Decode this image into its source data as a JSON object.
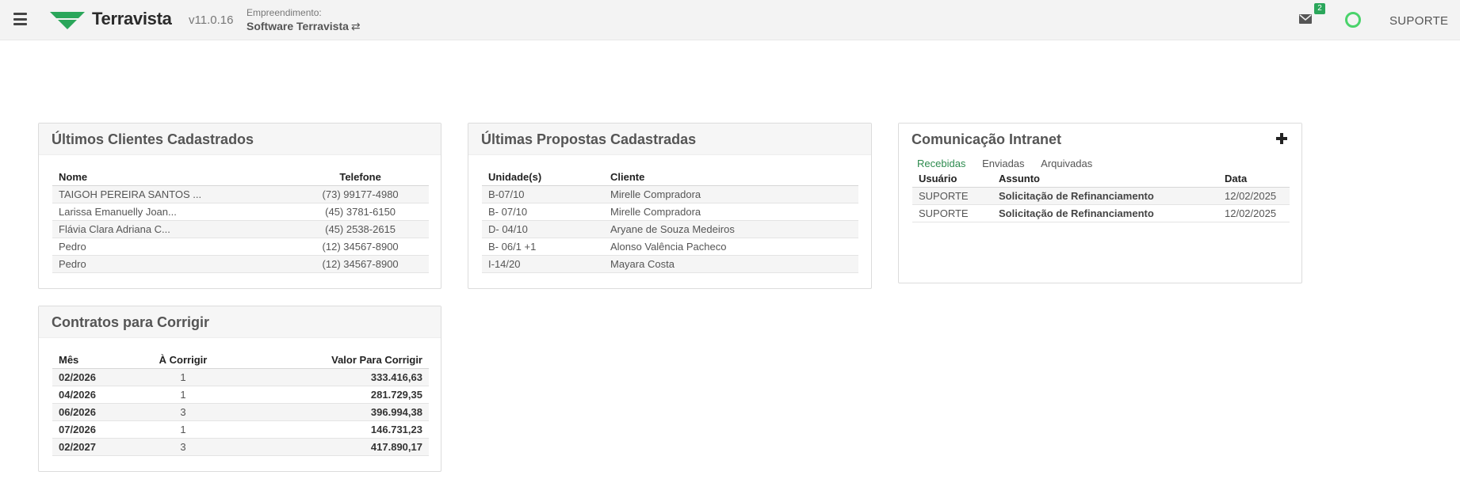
{
  "header": {
    "app_name": "Terravista",
    "version": "v11.0.16",
    "empreendimento_label": "Empreendimento:",
    "empreendimento_value": "Software Terravista",
    "swap_glyph": "⇄",
    "mail_badge": "2",
    "user_name": "SUPORTE",
    "brand_color": "#2aa65a",
    "status_color": "#4ad36b"
  },
  "clientes": {
    "title": "Últimos Clientes Cadastrados",
    "columns": [
      "Nome",
      "Telefone"
    ],
    "rows": [
      {
        "nome": "TAIGOH PEREIRA SANTOS ...",
        "telefone": "(73) 99177-4980"
      },
      {
        "nome": "Larissa Emanuelly Joan...",
        "telefone": "(45) 3781-6150"
      },
      {
        "nome": "Flávia Clara Adriana C...",
        "telefone": "(45) 2538-2615"
      },
      {
        "nome": "Pedro",
        "telefone": "(12) 34567-8900"
      },
      {
        "nome": "Pedro",
        "telefone": "(12) 34567-8900"
      }
    ]
  },
  "propostas": {
    "title": "Últimas Propostas Cadastradas",
    "columns": [
      "Unidade(s)",
      "Cliente"
    ],
    "rows": [
      {
        "unidade": "B-07/10",
        "cliente": "Mirelle Compradora"
      },
      {
        "unidade": "B- 07/10",
        "cliente": "Mirelle Compradora"
      },
      {
        "unidade": "D- 04/10",
        "cliente": "Aryane de Souza Medeiros"
      },
      {
        "unidade": "B- 06/1 +1",
        "cliente": "Alonso Valência Pacheco"
      },
      {
        "unidade": "I-14/20",
        "cliente": "Mayara Costa"
      }
    ]
  },
  "intranet": {
    "title": "Comunicação Intranet",
    "tabs": [
      "Recebidas",
      "Enviadas",
      "Arquivadas"
    ],
    "columns": [
      "Usuário",
      "Assunto",
      "Data"
    ],
    "rows": [
      {
        "usuario": "SUPORTE",
        "assunto": "Solicitação de Refinanciamento",
        "data": "12/02/2025"
      },
      {
        "usuario": "SUPORTE",
        "assunto": "Solicitação de Refinanciamento",
        "data": "12/02/2025"
      }
    ]
  },
  "contratos": {
    "title": "Contratos para Corrigir",
    "columns": [
      "Mês",
      "À Corrigir",
      "Valor Para Corrigir"
    ],
    "rows": [
      {
        "mes": "02/2026",
        "qtd": "1",
        "valor": "333.416,63"
      },
      {
        "mes": "04/2026",
        "qtd": "1",
        "valor": "281.729,35"
      },
      {
        "mes": "06/2026",
        "qtd": "3",
        "valor": "396.994,38"
      },
      {
        "mes": "07/2026",
        "qtd": "1",
        "valor": "146.731,23"
      },
      {
        "mes": "02/2027",
        "qtd": "3",
        "valor": "417.890,17"
      }
    ]
  }
}
